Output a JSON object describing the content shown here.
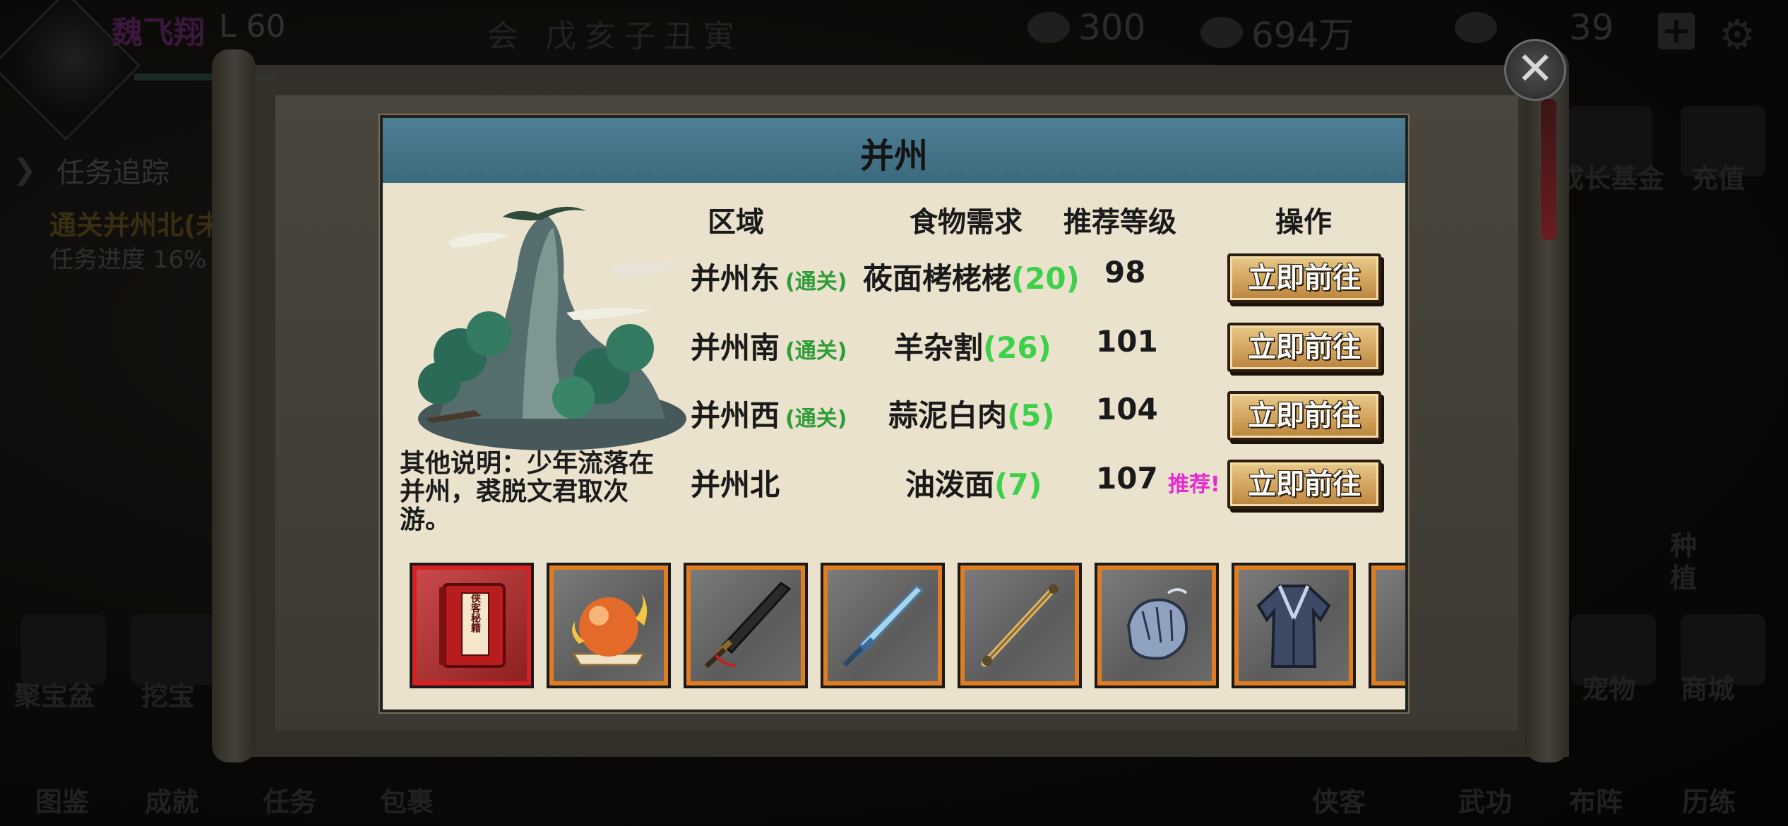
{
  "hud": {
    "player_name": "魏飞翔",
    "player_level": "L 60",
    "quest_title": "任务追踪",
    "quest_target": "通关并州北(未",
    "quest_progress": "任务进度 16%",
    "date_text": "会 戊亥子丑寅",
    "stat_food": "300",
    "stat_money": "694万",
    "stat_gold": "39",
    "side_menu": {
      "growth_fund": "成长基金",
      "recharge": "充值",
      "plant": "种植",
      "treasure_bowl": "聚宝盆",
      "dig": "挖宝",
      "pets": "宠物",
      "shop": "商城",
      "atlas": "图鉴",
      "achievements": "成就",
      "tasks": "任务",
      "bag": "包裹",
      "heroes": "侠客",
      "martial_arts": "武功",
      "formation": "布阵",
      "training": "历练"
    }
  },
  "dialog": {
    "title": "并州",
    "description": "其他说明：少年流落在并州，裘脱文君取次游。",
    "columns": {
      "region": "区域",
      "food": "食物需求",
      "level": "推荐等级",
      "action": "操作"
    },
    "rows": [
      {
        "region": "并州东",
        "cleared": "(通关)",
        "food": "莜面栲栳栳",
        "qty": "(20)",
        "level": "98",
        "recommend": "",
        "action": "立即前往"
      },
      {
        "region": "并州南",
        "cleared": "(通关)",
        "food": "羊杂割",
        "qty": "(26)",
        "level": "101",
        "recommend": "",
        "action": "立即前往"
      },
      {
        "region": "并州西",
        "cleared": "(通关)",
        "food": "蒜泥白肉",
        "qty": "(5)",
        "level": "104",
        "recommend": "",
        "action": "立即前往"
      },
      {
        "region": "并州北",
        "cleared": "",
        "food": "油泼面",
        "qty": "(7)",
        "level": "107",
        "recommend": "推荐!",
        "action": "立即前往"
      }
    ],
    "rewards": [
      {
        "icon": "book-icon",
        "label": "侠客秘籍"
      },
      {
        "icon": "orb-icon",
        "label": ""
      },
      {
        "icon": "broadsword-icon",
        "label": ""
      },
      {
        "icon": "sword-icon",
        "label": ""
      },
      {
        "icon": "staff-icon",
        "label": ""
      },
      {
        "icon": "gauntlet-icon",
        "label": ""
      },
      {
        "icon": "robe-icon",
        "label": ""
      }
    ]
  },
  "colors": {
    "header_blue": "#4d7f95",
    "parchment": "#eae2cd",
    "cleared_green": "#2e9c37",
    "qty_green": "#3ed04b",
    "recommend_magenta": "#e52bd0",
    "item_border_orange": "#e07d21",
    "item_border_red": "#d92020"
  }
}
